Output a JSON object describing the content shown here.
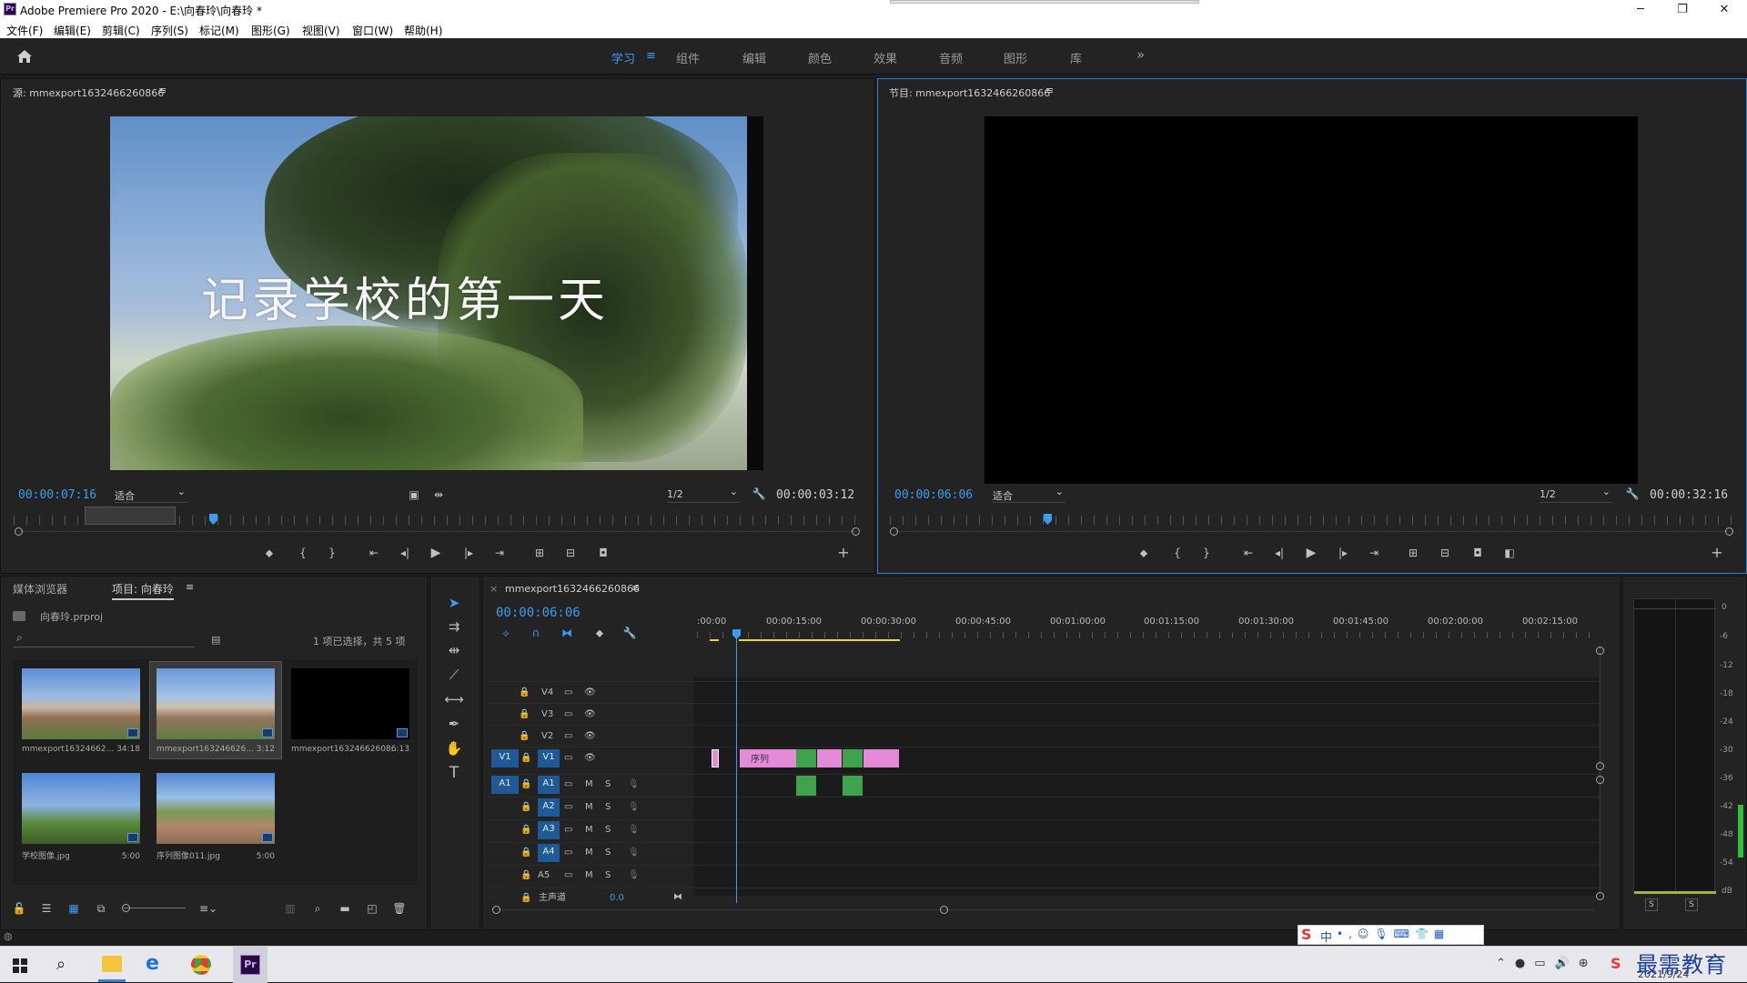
{
  "titlebar": {
    "title": "Adobe Premiere Pro 2020 - E:\\向春玲\\向春玲 *",
    "icon": "Pr",
    "minimize": "─",
    "maximize": "❐",
    "close": "✕"
  },
  "menu": [
    "文件(F)",
    "编辑(E)",
    "剪辑(C)",
    "序列(S)",
    "标记(M)",
    "图形(G)",
    "视图(V)",
    "窗口(W)",
    "帮助(H)"
  ],
  "workspaces": {
    "items": [
      "学习",
      "组件",
      "编辑",
      "颜色",
      "效果",
      "音频",
      "图形",
      "库"
    ],
    "active": "学习",
    "more": "»"
  },
  "source": {
    "title": "源: mmexport1632466260866",
    "timecode": "00:00:07:16",
    "fit": "适合",
    "quality": "1/2",
    "duration": "00:00:03:12",
    "overlay_text": "记录学校的第一天"
  },
  "program": {
    "title": "节目: mmexport1632466260866",
    "timecode": "00:00:06:06",
    "fit": "适合",
    "quality": "1/2",
    "duration": "00:00:32:16"
  },
  "project": {
    "tabs": [
      "媒体浏览器",
      "项目: 向春玲"
    ],
    "active_tab": "项目: 向春玲",
    "file": "向春玲.prproj",
    "selection": "1 项已选择，共 5 项",
    "items": [
      {
        "name": "mmexport16324662…",
        "duration": "34:18"
      },
      {
        "name": "mmexport163246626…",
        "duration": "3:12"
      },
      {
        "name": "mmexport16324662608…",
        "duration": "6:13"
      },
      {
        "name": "学校图像.jpg",
        "duration": "5:00"
      },
      {
        "name": "序列图像011.jpg",
        "duration": "5:00"
      }
    ]
  },
  "timeline": {
    "title": "mmexport1632466260866",
    "timecode": "00:00:06:06",
    "ruler": [
      ":00:00",
      "00:00:15:00",
      "00:00:30:00",
      "00:00:45:00",
      "00:01:00:00",
      "00:01:15:00",
      "00:01:30:00",
      "00:01:45:00",
      "00:02:00:00",
      "00:02:15:00"
    ],
    "video_tracks": [
      "V4",
      "V3",
      "V2",
      "V1"
    ],
    "audio_tracks": [
      "A1",
      "A2",
      "A3",
      "A4",
      "A5"
    ],
    "source_patch_v": "V1",
    "source_patch_a": "A1",
    "master": "主声道",
    "master_value": "0.0",
    "clip_label": "序列",
    "mute": "M",
    "solo": "S"
  },
  "meter": {
    "scale": [
      "0",
      "-6",
      "-12",
      "-18",
      "-24",
      "-30",
      "-36",
      "-42",
      "-48",
      "-54",
      "dB"
    ],
    "solo_left": "S",
    "solo_right": "S"
  },
  "ime": {
    "label": "中"
  },
  "taskbar": {
    "date": "2021/9/24",
    "watermark": "最需教育"
  },
  "colors": {
    "accent": "#3e9cf0",
    "clip_pink": "#e58ad9",
    "clip_green": "#3fa34d"
  }
}
